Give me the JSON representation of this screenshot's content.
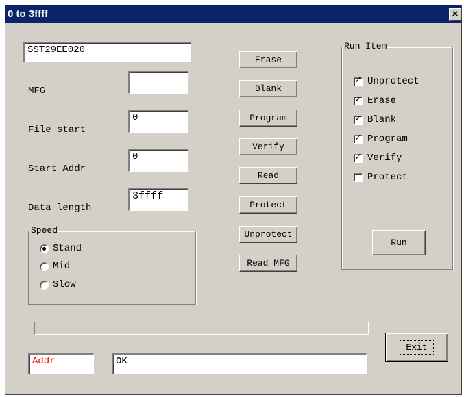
{
  "window": {
    "title": "0 to 3ffff",
    "close_label": "×"
  },
  "device": {
    "value": "SST29EE020"
  },
  "fields": {
    "mfg": {
      "label": "MFG",
      "value": ""
    },
    "file_start": {
      "label": "File start",
      "value": "0"
    },
    "start_addr": {
      "label": "Start Addr",
      "value": "0"
    },
    "data_length": {
      "label": "Data length",
      "value": "3ffff"
    }
  },
  "speed": {
    "title": "Speed",
    "options": [
      {
        "label": "Stand",
        "selected": true
      },
      {
        "label": "Mid",
        "selected": false
      },
      {
        "label": "Slow",
        "selected": false
      }
    ]
  },
  "actions": {
    "erase": "Erase",
    "blank": "Blank",
    "program": "Program",
    "verify": "Verify",
    "read": "Read",
    "protect": "Protect",
    "unprotect": "Unprotect",
    "read_mfg": "Read MFG"
  },
  "run_item": {
    "title": "Run Item",
    "items": [
      {
        "label": "Unprotect",
        "checked": true
      },
      {
        "label": "Erase",
        "checked": true
      },
      {
        "label": "Blank",
        "checked": true
      },
      {
        "label": "Program",
        "checked": true
      },
      {
        "label": "Verify",
        "checked": true
      },
      {
        "label": "Protect",
        "checked": false
      }
    ],
    "run_label": "Run"
  },
  "progress": {
    "value": 0
  },
  "status": {
    "addr_label": "Addr",
    "addr_color": "#ff0000",
    "message": "OK"
  },
  "exit_label": "Exit"
}
